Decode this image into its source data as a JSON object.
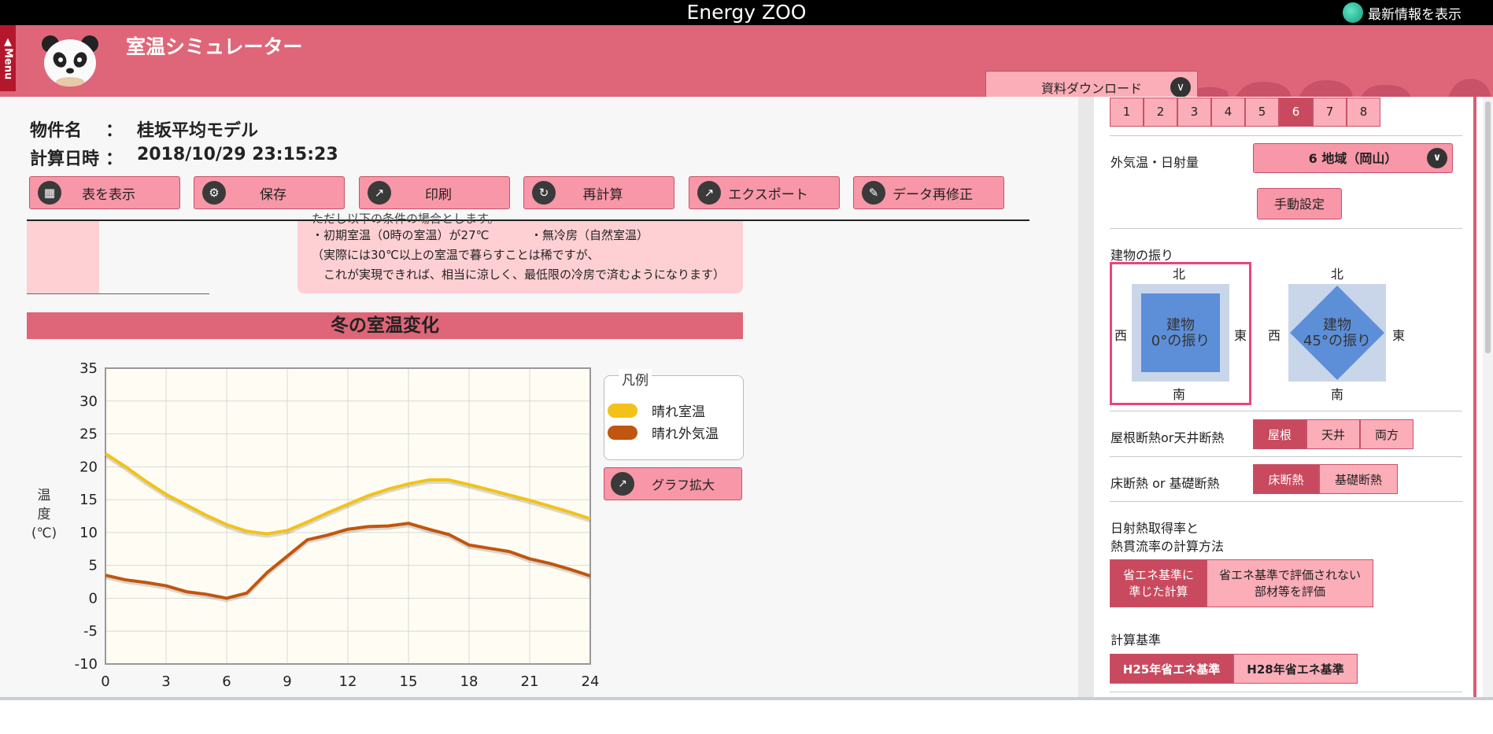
{
  "app": {
    "title": "Energy ZOO",
    "news_label": "最新情報を表示",
    "menu_tab": "▲Menu"
  },
  "header": {
    "title": "室温シミュレーター",
    "download_select": "資料ダウンロード"
  },
  "info": {
    "property_label": "物件名",
    "property_sep": "：",
    "property_value": "桂坂平均モデル",
    "date_label": "計算日時",
    "date_sep": "：",
    "date_value": "2018/10/29 23:15:23"
  },
  "toolbar": [
    {
      "label": "表を表示",
      "icon": "grid-icon"
    },
    {
      "label": "保存",
      "icon": "gear-icon"
    },
    {
      "label": "印刷",
      "icon": "share-icon"
    },
    {
      "label": "再計算",
      "icon": "refresh-icon"
    },
    {
      "label": "エクスポート",
      "icon": "share-icon"
    },
    {
      "label": "データ再修正",
      "icon": "pencil-icon"
    }
  ],
  "note": {
    "line0": "ただし以下の条件の場合とします。",
    "line1a": "・初期室温（0時の室温）が27℃",
    "line1b": "・無冷房（自然室温）",
    "line2": "（実際には30℃以上の室温で暮らすことは稀ですが、",
    "line3": "　これが実現できれば、相当に涼しく、最低限の冷房で済むようになります）"
  },
  "chart_title": "冬の室温変化",
  "legend": {
    "title": "凡例"
  },
  "zoom_button": "グラフ拡大",
  "chart_data": {
    "type": "line",
    "ylabel": "温度(℃)",
    "ylabel_chars": [
      "温",
      "度",
      "(℃)"
    ],
    "xlabel": "",
    "xlim": [
      0,
      24
    ],
    "ylim": [
      -10,
      35
    ],
    "x_ticks": [
      0,
      3,
      6,
      9,
      12,
      15,
      18,
      21,
      24
    ],
    "y_ticks": [
      35,
      30,
      25,
      20,
      15,
      10,
      5,
      0,
      -5,
      -10
    ],
    "grid": true,
    "legend_position": "right",
    "series": [
      {
        "name": "晴れ室温",
        "color": "#f2c21a",
        "x": [
          0,
          1,
          2,
          3,
          4,
          5,
          6,
          7,
          8,
          9,
          10,
          11,
          12,
          13,
          14,
          15,
          16,
          17,
          18,
          19,
          20,
          21,
          22,
          23,
          24
        ],
        "y": [
          22,
          20,
          17.8,
          15.8,
          14.2,
          12.6,
          11.2,
          10.2,
          9.8,
          10.3,
          11.6,
          13,
          14.3,
          15.6,
          16.6,
          17.4,
          18,
          18,
          17.3,
          16.5,
          15.7,
          14.9,
          14,
          13.1,
          12.1
        ]
      },
      {
        "name": "晴れ外気温",
        "color": "#c0560f",
        "x": [
          0,
          1,
          2,
          3,
          4,
          5,
          6,
          7,
          8,
          9,
          10,
          11,
          12,
          13,
          14,
          15,
          16,
          17,
          18,
          19,
          20,
          21,
          22,
          23,
          24
        ],
        "y": [
          3.5,
          2.8,
          2.4,
          1.9,
          1,
          0.6,
          0,
          0.8,
          3.9,
          6.4,
          8.9,
          9.6,
          10.5,
          10.9,
          11,
          11.4,
          10.5,
          9.7,
          8.1,
          7.6,
          7.1,
          6,
          5.3,
          4.4,
          3.4
        ]
      }
    ]
  },
  "rpanel": {
    "regions": [
      "1",
      "2",
      "3",
      "4",
      "5",
      "6",
      "7",
      "8"
    ],
    "selected_region": "6",
    "outside_label": "外気温・日射量",
    "area_select": "6 地域（岡山）",
    "manual_button": "手動設定",
    "orientation_label": "建物の振り",
    "orient0": {
      "n": "北",
      "s": "南",
      "w": "西",
      "e": "東",
      "line1": "建物",
      "line2": "0°の振り"
    },
    "orient45": {
      "n": "北",
      "s": "南",
      "w": "西",
      "e": "東",
      "line1": "建物",
      "line2": "45°の振り"
    },
    "roof_label": "屋根断熱or天井断熱",
    "roof_options": [
      "屋根",
      "天井",
      "両方"
    ],
    "floor_label": "床断熱 or 基礎断熱",
    "floor_options": [
      "床断熱",
      "基礎断熱"
    ],
    "calc_label1": "日射熱取得率と",
    "calc_label2": "熱貫流率の計算方法",
    "calc_opt1_l1": "省エネ基準に",
    "calc_opt1_l2": "準じた計算",
    "calc_opt2_l1": "省エネ基準で評価されない",
    "calc_opt2_l2": "部材等を評価",
    "standard_label": "計算基準",
    "standard_options": [
      "H25年省エネ基準",
      "H28年省エネ基準"
    ]
  },
  "colors": {
    "header": "#de6678",
    "button": "#f797a7",
    "selected": "#c94a5e",
    "chart_bg": "#fffdf3"
  }
}
